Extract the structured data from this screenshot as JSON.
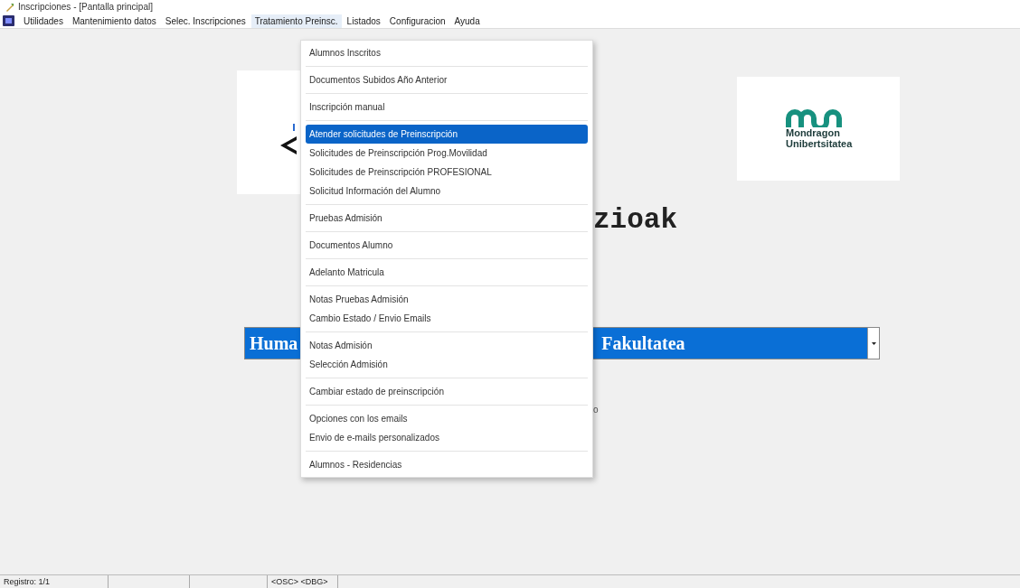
{
  "window": {
    "title": "Inscripciones - [Pantalla principal]"
  },
  "menu_bar": [
    {
      "label": "Utilidades",
      "selected": false
    },
    {
      "label": "Mantenimiento datos",
      "selected": false
    },
    {
      "label": "Selec. Inscripciones",
      "selected": false
    },
    {
      "label": "Tratamiento Preinsc.",
      "selected": true
    },
    {
      "label": "Listados",
      "selected": false
    },
    {
      "label": "Configuracion",
      "selected": false
    },
    {
      "label": "Ayuda",
      "selected": false
    }
  ],
  "dropdown_menu": {
    "groups": [
      [
        {
          "label": "Alumnos Inscritos",
          "selected": false
        }
      ],
      [
        {
          "label": "Documentos Subidos Año Anterior",
          "selected": false
        }
      ],
      [
        {
          "label": "Inscripción manual",
          "selected": false
        }
      ],
      [
        {
          "label": "Atender solicitudes de Preinscripción",
          "selected": true
        },
        {
          "label": "Solicitudes de Preinscripción Prog.Movilidad",
          "selected": false
        },
        {
          "label": "Solicitudes de Preinscripción PROFESIONAL",
          "selected": false
        },
        {
          "label": "Solicitud Información del Alumno",
          "selected": false
        }
      ],
      [
        {
          "label": "Pruebas Admisión",
          "selected": false
        }
      ],
      [
        {
          "label": "Documentos Alumno",
          "selected": false
        }
      ],
      [
        {
          "label": "Adelanto Matricula",
          "selected": false
        }
      ],
      [
        {
          "label": "Notas Pruebas Admisión",
          "selected": false
        },
        {
          "label": "Cambio Estado / Envio Emails",
          "selected": false
        }
      ],
      [
        {
          "label": "Notas Admisión",
          "selected": false
        },
        {
          "label": "Selección Admisión",
          "selected": false
        }
      ],
      [
        {
          "label": "Cambiar estado de preinscripción",
          "selected": false
        }
      ],
      [
        {
          "label": "Opciones con los emails",
          "selected": false
        },
        {
          "label": "Envio de e-mails personalizados",
          "selected": false
        }
      ],
      [
        {
          "label": "Alumnos - Residencias",
          "selected": false
        }
      ]
    ]
  },
  "main": {
    "logo_text": [
      "Mondragon",
      "Unibertsitatea"
    ],
    "heading_visible": "zioak",
    "faculty_select": {
      "visible_start": "Huma",
      "visible_end": "Fakultatea"
    },
    "partial_text": "o"
  },
  "status_bar": {
    "record": "Registro: 1/1",
    "flags": "<OSC> <DBG>"
  }
}
